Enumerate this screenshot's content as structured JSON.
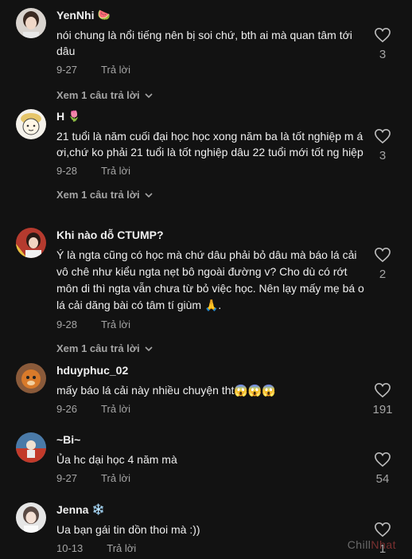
{
  "comments": [
    {
      "username": "YenNhi",
      "badge": "🍉",
      "text": "nói chung là nổi tiếng nên bị soi chứ, bth ai mà quan tâm tới dâu",
      "date": "9-27",
      "reply_label": "Trả lời",
      "view_replies": "Xem 1 câu trả lời",
      "likes": "3"
    },
    {
      "username": "H",
      "badge": "🌷",
      "text": "21 tuổi là năm cuối đại học học xong năm ba là tốt nghiệp m á ơi,chứ ko phải 21 tuổi là tốt nghiệp dâu 22 tuổi mới tốt ng hiệp",
      "date": "9-28",
      "reply_label": "Trả lời",
      "view_replies": "Xem 1 câu trả lời",
      "likes": "3"
    },
    {
      "username": "Khi nào dỗ CTUMP?",
      "badge": "",
      "text": "Ý là ngta cũng có học mà chứ dâu phải bỏ dâu mà báo lá cải vô chê như kiểu ngta nẹt bô ngoài đường v? Cho dù có rớt môn di thì ngta vẫn chưa từ bỏ việc học. Nên lạy mấy mẹ bá o lá cải dăng bài có tâm tí giùm 🙏.",
      "date": "9-28",
      "reply_label": "Trả lời",
      "view_replies": "Xem 1 câu trả lời",
      "likes": "2"
    },
    {
      "username": "hduyphuc_02",
      "badge": "",
      "text": "mấy báo lá cải này nhiều chuyện tht😱😱😱",
      "date": "9-26",
      "reply_label": "Trả lời",
      "view_replies": "",
      "likes": "191"
    },
    {
      "username": "~Bi~",
      "badge": "",
      "text": "Ủa hc dại học 4 năm mà",
      "date": "9-27",
      "reply_label": "Trả lời",
      "view_replies": "",
      "likes": "54"
    },
    {
      "username": "Jenna",
      "badge": "❄️",
      "text": "Ua bạn gái tin dồn thoi mà :))",
      "date": "10-13",
      "reply_label": "Trả lời",
      "view_replies": "",
      "likes": "1"
    }
  ],
  "watermark": {
    "part1": "Chill",
    "part2": "Nhat"
  },
  "colors": {
    "background": "#121212",
    "text": "#efefef",
    "muted": "#a5a5a5"
  }
}
